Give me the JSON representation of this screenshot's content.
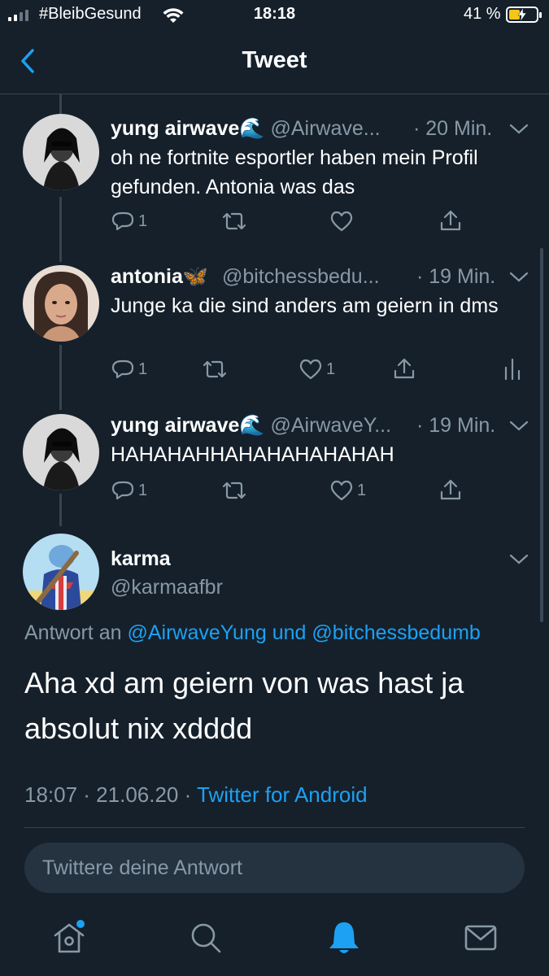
{
  "status_bar": {
    "carrier": "#BleibGesund",
    "time": "18:18",
    "battery": "41 %",
    "battery_level": 0.41,
    "accent_color": "#f5c518"
  },
  "nav": {
    "title": "Tweet",
    "back_icon": "chevron-left-icon"
  },
  "tweets": [
    {
      "name": "yung airwave🌊",
      "handle": "@Airwave...",
      "time": "· 20 Min.",
      "text": "oh ne fortnite esportler haben mein Profil gefunden. Antonia was das",
      "replies": "1",
      "retweets": "",
      "likes": ""
    },
    {
      "name": "antonia🦋",
      "handle": "@bitchessbedu...",
      "time": "· 19 Min.",
      "text": "Junge ka die sind anders am geiern in dms",
      "replies": "1",
      "retweets": "",
      "likes": "1"
    },
    {
      "name": "yung airwave🌊",
      "handle": "@AirwaveY...",
      "time": "· 19 Min.",
      "text": "HAHAHAHHAHAHAHAHAHAH",
      "replies": "1",
      "retweets": "",
      "likes": "1"
    }
  ],
  "main_tweet": {
    "name": "karma",
    "handle": "@karmaafbr",
    "reply_prefix": "Antwort an",
    "mention1": "@AirwaveYung",
    "reply_joiner": "und",
    "mention2": "@bitchessbedumb",
    "text": "Aha xd am geiern von was hast ja absolut nix xdddd",
    "timestamp": "18:07 · 21.06.20 ·",
    "source": "Twitter for Android"
  },
  "reply_input": {
    "placeholder": "Twittere deine Antwort"
  },
  "tab_bar": {
    "items": [
      "home-icon",
      "search-icon",
      "notifications-icon",
      "messages-icon"
    ],
    "active": "notifications-icon"
  },
  "colors": {
    "background": "#15202b",
    "link": "#1da1f2",
    "muted": "#8899a6",
    "divider": "#38444d"
  }
}
